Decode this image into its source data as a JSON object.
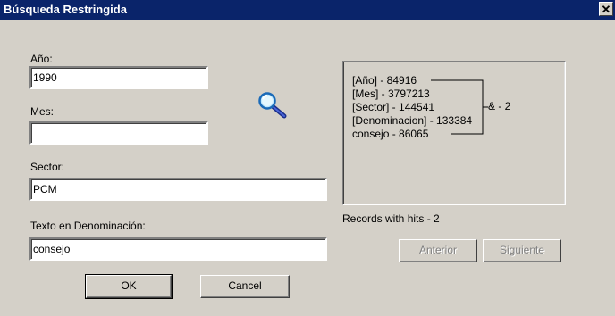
{
  "dialog": {
    "title": "Búsqueda Restringida",
    "close_glyph": "✕"
  },
  "form": {
    "year_label": "Año:",
    "year_value": "1990",
    "month_label": "Mes:",
    "month_value": "",
    "sector_label": "Sector:",
    "sector_value": "PCM",
    "text_label": "Texto en Denominación:",
    "text_value": "consejo",
    "search_icon": "magnifier-icon"
  },
  "results": {
    "lines": [
      "[Año] - 84916",
      "[Mes] - 3797213",
      "[Sector] - 144541",
      "[Denominacion] - 133384",
      "consejo - 86065"
    ],
    "combined": "& - 2",
    "summary": "Records with hits - 2"
  },
  "buttons": {
    "previous": "Anterior",
    "next": "Siguiente",
    "ok": "OK",
    "cancel": "Cancel"
  },
  "colors": {
    "title_bar": "#0a246a",
    "dialog_bg": "#d4d0c8"
  }
}
